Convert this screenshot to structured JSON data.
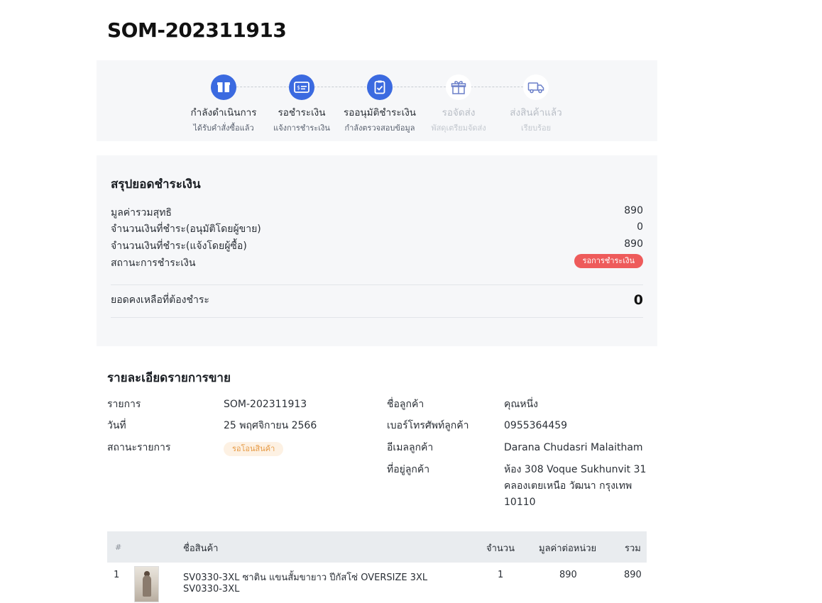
{
  "order": {
    "id": "SOM-202311913"
  },
  "progress": {
    "steps": [
      {
        "title": "กำลังดำเนินการ",
        "subtitle": "ได้รับคำสั่งซื้อแล้ว",
        "icon": "box-icon",
        "active": true
      },
      {
        "title": "รอชำระเงิน",
        "subtitle": "แจ้งการชำระเงิน",
        "icon": "payment-card-icon",
        "active": true
      },
      {
        "title": "รออนุมัติชำระเงิน",
        "subtitle": "กำลังตรวจสอบข้อมูล",
        "icon": "document-check-icon",
        "active": true
      },
      {
        "title": "รอจัดส่ง",
        "subtitle": "พัสดุเตรียมจัดส่ง",
        "icon": "gift-box-icon",
        "active": false
      },
      {
        "title": "ส่งสินค้าแล้ว",
        "subtitle": "เรียบร้อย",
        "icon": "truck-icon",
        "active": false
      }
    ]
  },
  "summary": {
    "title": "สรุปยอดชำระเงิน",
    "rows": [
      {
        "label": "มูลค่ารวมสุทธิ",
        "value": "890"
      },
      {
        "label": "จำนวนเงินที่ชำระ(อนุมัติโดยผู้ขาย)",
        "value": "0"
      },
      {
        "label": "จำนวนเงินที่ชำระ(แจ้งโดยผู้ซื้อ)",
        "value": "890"
      }
    ],
    "status_label": "สถานะการชำระเงิน",
    "status_value": "รอการชำระเงิน",
    "balance_label": "ยอดคงเหลือที่ต้องชำระ",
    "balance_value": "0"
  },
  "details": {
    "title": "รายละเอียดรายการขาย",
    "left": {
      "order_label": "รายการ",
      "order_value": "SOM-202311913",
      "date_label": "วันที่",
      "date_value": "25 พฤศจิกายน 2566",
      "status_label": "สถานะรายการ",
      "status_value": "รอโอนสินค้า"
    },
    "right": {
      "name_label": "ชื่อลูกค้า",
      "name_value": "คุณหนึ่ง",
      "phone_label": "เบอร์โทรศัพท์ลูกค้า",
      "phone_value": "0955364459",
      "email_label": "อีเมลลูกค้า",
      "email_value": "Darana Chudasri Malaitham",
      "address_label": "ที่อยู่ลูกค้า",
      "address_lines": [
        "ห้อง 308 Voque Sukhunvit 31",
        "คลองเตยเหนือ วัฒนา กรุงเทพ",
        "10110"
      ]
    }
  },
  "table": {
    "headers": {
      "index": "#",
      "name": "ชื่อสินค้า",
      "qty": "จำนวน",
      "unit_price": "มูลค่าต่อหน่วย",
      "total": "รวม"
    },
    "rows": [
      {
        "index": "1",
        "name": "SV0330-3XL ซาติน แขนสั้มขายาว ปีกัสโซ่ OVERSIZE 3XL",
        "sku": "SV0330-3XL",
        "qty": "1",
        "unit_price": "890",
        "total": "890"
      }
    ]
  },
  "colors": {
    "accent": "#3b6ae0",
    "status_red": "#ee5b5b",
    "badge_bg": "#fdf1e3",
    "badge_text": "#e69a45",
    "panel_bg": "#f6f7f9"
  }
}
